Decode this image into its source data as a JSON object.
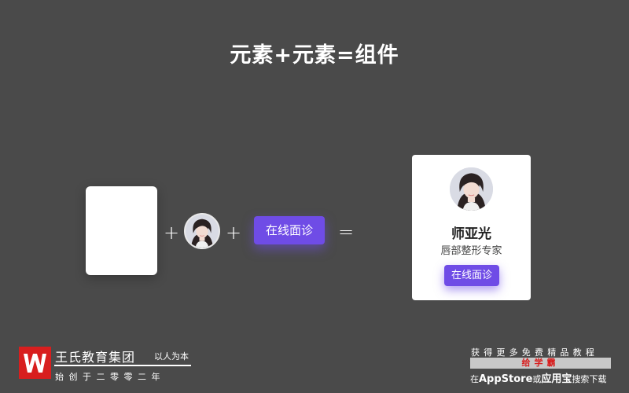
{
  "title": "元素+元素=组件",
  "operators": {
    "plus": "+",
    "equals": "="
  },
  "button_label": "在线面诊",
  "card": {
    "name": "师亚光",
    "role": "唇部整形专家",
    "button_label": "在线面诊"
  },
  "footer_left": {
    "brand": "王氏教育集团",
    "slogan": "以人为本",
    "founded": "始创于二零零二年"
  },
  "footer_right": {
    "promo": "获得更多免费精品教程",
    "app_name": "给学霸",
    "store_prefix": "在",
    "store_1": "AppStore",
    "or": "或",
    "store_2": "应用宝",
    "suffix": "搜索下载"
  },
  "colors": {
    "background": "#4a4a4a",
    "accent": "#6f4ce6",
    "brand_red": "#d81e1e"
  },
  "icons": [
    "avatar-portrait",
    "wang-logo"
  ]
}
